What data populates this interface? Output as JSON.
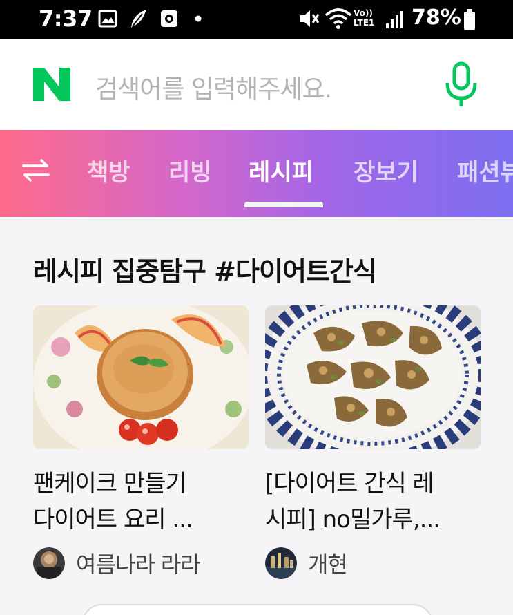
{
  "status_bar": {
    "time": "7:37",
    "battery": "78%",
    "network": "Vo)) LTE1",
    "icons": [
      "gallery-icon",
      "leaf-icon",
      "media-icon",
      "dot-icon",
      "mute-icon",
      "wifi-icon",
      "signal-icon",
      "battery-icon"
    ]
  },
  "search": {
    "logo": "N",
    "placeholder": "검색어를 입력해주세요.",
    "brand_color": "#03c75a"
  },
  "tabs": {
    "items": [
      "책방",
      "리빙",
      "레시피",
      "장보기",
      "패션뷰"
    ],
    "active": "레시피"
  },
  "section": {
    "title": "레시피 집중탐구 #다이어트간식"
  },
  "cards": [
    {
      "title_lines": [
        "팬케이크 만들기",
        "다이어트 요리 ..."
      ],
      "author": "여름나라 라라",
      "image": "pancake-photo"
    },
    {
      "title_lines": [
        "[다이어트 간식 레",
        "시피] no밀가루,..."
      ],
      "author": "개현",
      "image": "granola-photo"
    }
  ]
}
